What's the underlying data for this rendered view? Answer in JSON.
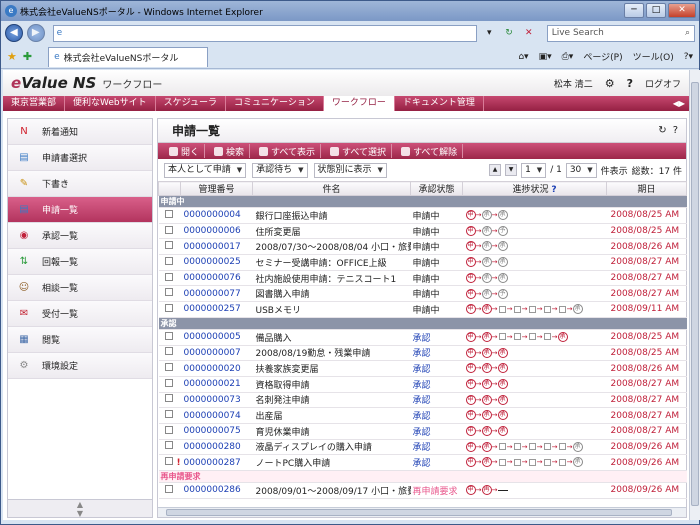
{
  "window": {
    "title": "株式会社eValueNSポータル - Windows Internet Explorer",
    "min": "─",
    "max": "□",
    "close": "✕"
  },
  "browser": {
    "url": "",
    "search_placeholder": "Live Search",
    "tab_label": "株式会社eValueNSポータル",
    "page_menu": "ページ(P)",
    "tools_menu": "ツール(O)",
    "refresh": "↻",
    "stop": "✕"
  },
  "app": {
    "logo_e": "e",
    "logo_rest": "Value NS",
    "subtitle": "ワークフロー",
    "user": "松本 清二",
    "logout": "ログオフ",
    "menu": [
      "東京営業部",
      "便利なWebサイト",
      "スケジューラ",
      "コミュニケーション",
      "ワークフロー",
      "ドキュメント管理"
    ],
    "menu_active": 4
  },
  "sidebar": {
    "items": [
      {
        "label": "新着通知",
        "icon": "new-icon",
        "sym": "N",
        "color": "#d0202c"
      },
      {
        "label": "申請書選択",
        "icon": "document-icon",
        "sym": "▤",
        "color": "#3a7ac4"
      },
      {
        "label": "下書き",
        "icon": "pencil-icon",
        "sym": "✎",
        "color": "#c89010"
      },
      {
        "label": "申請一覧",
        "icon": "documents-icon",
        "sym": "▤",
        "color": "#3a7ac4"
      },
      {
        "label": "承認一覧",
        "icon": "stamp-icon",
        "sym": "◉",
        "color": "#c0203a"
      },
      {
        "label": "回報一覧",
        "icon": "circulate-icon",
        "sym": "⇅",
        "color": "#2a9a3a"
      },
      {
        "label": "相談一覧",
        "icon": "people-icon",
        "sym": "☺",
        "color": "#8a5a20"
      },
      {
        "label": "受付一覧",
        "icon": "receive-icon",
        "sym": "✉",
        "color": "#c02030"
      },
      {
        "label": "閲覧",
        "icon": "view-icon",
        "sym": "▦",
        "color": "#406aa8"
      },
      {
        "label": "環境設定",
        "icon": "gear-icon",
        "sym": "⚙",
        "color": "#888"
      }
    ],
    "active": 3
  },
  "main": {
    "title": "申請一覧",
    "toolbar": [
      "開く",
      "検索",
      "すべて表示",
      "すべて選択",
      "すべて解除"
    ],
    "filter1": "本人として申請",
    "filter2": "承認待ち",
    "filter3": "状態別に表示",
    "page": "1",
    "page_total": "/ 1",
    "per_page": "30",
    "per_page_label": "件表示",
    "total": "総数：17 件",
    "columns": [
      "管理番号",
      "件名",
      "承認状態",
      "進捗状況",
      "期日"
    ],
    "help": "?"
  },
  "groups": [
    {
      "label": "申請中",
      "rows": [
        {
          "no": "0000000004",
          "name": "銀行口座振込申請",
          "status": "申請中",
          "steps": "A",
          "date": "2008/08/25 AM"
        },
        {
          "no": "0000000006",
          "name": "住所変更届",
          "status": "申請中",
          "steps": "B",
          "date": "2008/08/25 AM"
        },
        {
          "no": "0000000017",
          "name": "2008/07/30～2008/08/04 小口・旅費",
          "status": "申請中",
          "steps": "A",
          "date": "2008/08/26 AM"
        },
        {
          "no": "0000000025",
          "name": "セミナー受講申請：OFFICE上級",
          "status": "申請中",
          "steps": "A",
          "date": "2008/08/27 AM"
        },
        {
          "no": "0000000076",
          "name": "社内施設使用申請：テニスコート1",
          "status": "申請中",
          "steps": "A",
          "date": "2008/08/27 AM"
        },
        {
          "no": "0000000077",
          "name": "図書購入申請",
          "status": "申請中",
          "steps": "B",
          "date": "2008/08/27 AM"
        },
        {
          "no": "0000000257",
          "name": "USBメモリ",
          "status": "申請中",
          "steps": "C",
          "date": "2008/09/11 AM"
        }
      ]
    },
    {
      "label": "承認",
      "rows": [
        {
          "no": "0000000005",
          "name": "備品購入",
          "status": "承認",
          "steps": "D",
          "date": "2008/08/25 AM"
        },
        {
          "no": "0000000007",
          "name": "2008/08/19勤怠・残業申請",
          "status": "承認",
          "steps": "E",
          "date": "2008/08/25 AM"
        },
        {
          "no": "0000000020",
          "name": "扶養家族変更届",
          "status": "承認",
          "steps": "E",
          "date": "2008/08/26 AM"
        },
        {
          "no": "0000000021",
          "name": "資格取得申請",
          "status": "承認",
          "steps": "E",
          "date": "2008/08/27 AM"
        },
        {
          "no": "0000000073",
          "name": "名刺発注申請",
          "status": "承認",
          "steps": "E",
          "date": "2008/08/27 AM"
        },
        {
          "no": "0000000074",
          "name": "出産届",
          "status": "承認",
          "steps": "E",
          "date": "2008/08/27 AM"
        },
        {
          "no": "0000000075",
          "name": "育児休業申請",
          "status": "承認",
          "steps": "E",
          "date": "2008/08/27 AM"
        },
        {
          "no": "0000000280",
          "name": "液晶ディスプレイの購入申請",
          "status": "承認",
          "steps": "C",
          "date": "2008/09/26 AM"
        },
        {
          "no": "0000000287",
          "name": "ノートPC購入申請",
          "status": "承認",
          "steps": "C",
          "date": "2008/09/26 AM",
          "warn": "!"
        }
      ]
    },
    {
      "label": "再申請要求",
      "rows": [
        {
          "no": "0000000286",
          "name": "2008/09/01～2008/09/17 小口・旅費",
          "status": "再申請要求",
          "steps": "F",
          "date": "2008/09/26 AM"
        }
      ]
    }
  ],
  "colors": {
    "accent": "#b0335a",
    "link": "#1c3fb4",
    "date": "#c0203a"
  }
}
